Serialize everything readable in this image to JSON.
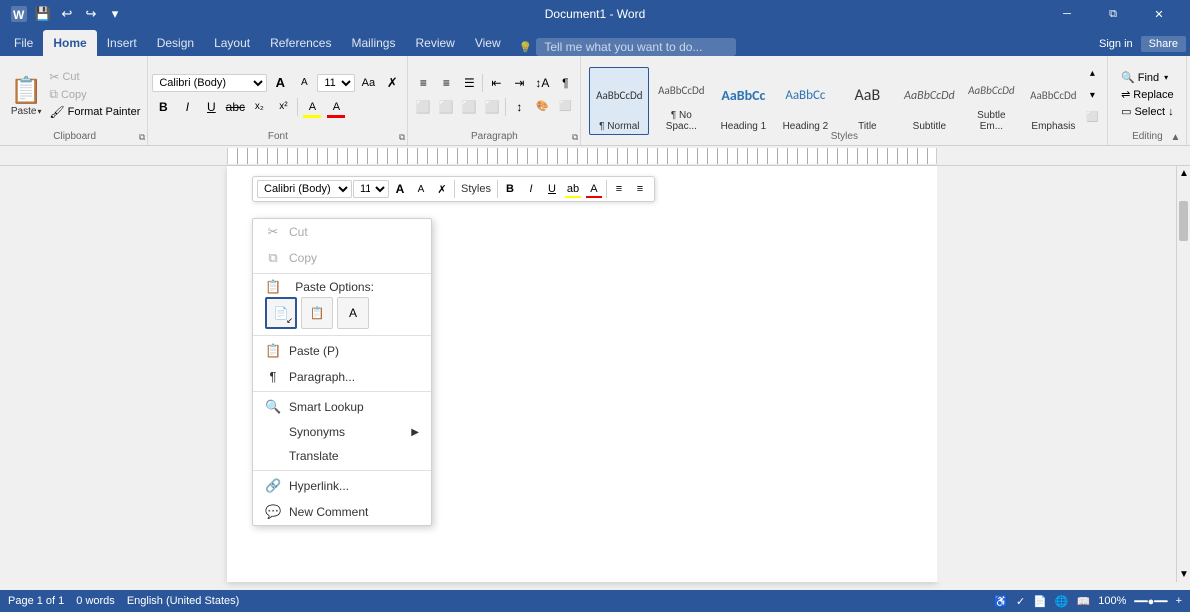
{
  "titlebar": {
    "title": "Document1 - Word",
    "quick_access": [
      "save",
      "undo",
      "redo",
      "customize"
    ],
    "controls": [
      "minimize",
      "restore",
      "close"
    ]
  },
  "tabs": {
    "items": [
      "File",
      "Home",
      "Insert",
      "Design",
      "Layout",
      "References",
      "Mailings",
      "Review",
      "View"
    ],
    "active": "Home",
    "tell": "Tell me what you want to do...",
    "sign_in": "Sign in",
    "share": "Share"
  },
  "ribbon": {
    "clipboard": {
      "label": "Clipboard",
      "paste_label": "Paste",
      "cut_label": "Cut",
      "copy_label": "Copy",
      "format_painter_label": "Format Painter"
    },
    "font": {
      "label": "Font",
      "font_name": "Calibri (Body)",
      "font_size": "11",
      "bold": "B",
      "italic": "I",
      "underline": "U",
      "strikethrough": "abc",
      "subscript": "x₂",
      "superscript": "x²"
    },
    "paragraph": {
      "label": "Paragraph"
    },
    "styles": {
      "label": "Styles",
      "items": [
        {
          "id": "normal",
          "label": "Normal",
          "preview": "AaBbCcDd"
        },
        {
          "id": "no-spacing",
          "label": "No Spac...",
          "preview": "AaBbCcDd"
        },
        {
          "id": "heading1",
          "label": "Heading 1",
          "preview": "AaBbCc"
        },
        {
          "id": "heading2",
          "label": "Heading 2",
          "preview": "AaBbCc"
        },
        {
          "id": "title",
          "label": "Title",
          "preview": "AaB"
        },
        {
          "id": "subtitle",
          "label": "Subtitle",
          "preview": "AaBbCcDd"
        },
        {
          "id": "subtle-em",
          "label": "Subtle Em...",
          "preview": "AaBbCcDd"
        },
        {
          "id": "emphasis",
          "label": "Emphasis",
          "preview": "AaBbCcDd"
        }
      ]
    },
    "editing": {
      "label": "Editing",
      "find_label": "Find",
      "replace_label": "Replace",
      "select_label": "Select ↓"
    }
  },
  "mini_toolbar": {
    "font_name": "Calibri (Body)",
    "font_size": "11",
    "grow_icon": "A",
    "shrink_icon": "A",
    "clear_icon": "✗",
    "styles_label": "Styles",
    "bold": "B",
    "italic": "I",
    "underline": "U",
    "highlight": "ab",
    "font_color": "A",
    "bullets": "≡",
    "numbering": "≡"
  },
  "context_menu": {
    "items": [
      {
        "id": "cut",
        "icon": "✂",
        "label": "Cut",
        "disabled": true
      },
      {
        "id": "copy",
        "icon": "⧉",
        "label": "Copy",
        "disabled": true
      },
      {
        "id": "paste-options",
        "label": "Paste Options:",
        "type": "section"
      },
      {
        "id": "paste-btn",
        "label": "Paste",
        "shortcut": "(P)"
      },
      {
        "id": "paragraph",
        "label": "Paragraph..."
      },
      {
        "id": "smart-lookup",
        "icon": "🔍",
        "label": "Smart Lookup"
      },
      {
        "id": "synonyms",
        "label": "Synonyms",
        "has_arrow": true
      },
      {
        "id": "translate",
        "label": "Translate"
      },
      {
        "id": "hyperlink",
        "icon": "🔗",
        "label": "Hyperlink..."
      },
      {
        "id": "new-comment",
        "icon": "💬",
        "label": "New Comment"
      }
    ]
  },
  "status_bar": {
    "page_info": "Page 1 of 1",
    "words": "0 words",
    "lang": "English (United States)",
    "zoom": "100%"
  }
}
